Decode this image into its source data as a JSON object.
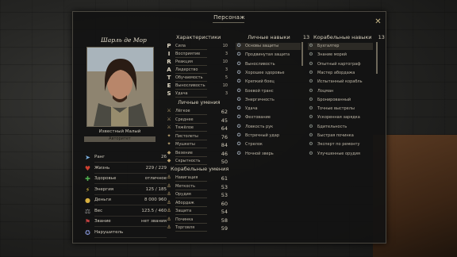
{
  "window": {
    "title": "Персонаж"
  },
  "character": {
    "name": "Шарль де Мор",
    "rank": "Известный Малый",
    "rank_bar": "Авторитет"
  },
  "stats": [
    {
      "icon": "arrow-icon",
      "glyph": "➤",
      "color": "#7ab0e0",
      "label": "Ранг",
      "value": "26"
    },
    {
      "icon": "heart-icon",
      "glyph": "♥",
      "color": "#d04030",
      "label": "Жизнь",
      "value": "229 / 229"
    },
    {
      "icon": "health-icon",
      "glyph": "✚",
      "color": "#50b050",
      "label": "Здоровье",
      "value": "отличное"
    },
    {
      "icon": "energy-icon",
      "glyph": "⚡",
      "color": "#e0c040",
      "label": "Энергия",
      "value": "125 / 185"
    },
    {
      "icon": "money-icon",
      "glyph": "●",
      "color": "#d8b040",
      "label": "Деньги",
      "value": "8 000 960"
    },
    {
      "icon": "weight-icon",
      "glyph": "⚖",
      "color": "#a0a0a0",
      "label": "Вес",
      "value": "123.5 / 460"
    },
    {
      "icon": "flag-icon",
      "glyph": "⚑",
      "color": "#c04040",
      "label": "Звание",
      "value": "нет звания"
    },
    {
      "icon": "compass-icon",
      "glyph": "✪",
      "color": "#8090d0",
      "label": "Нарушитель",
      "value": ""
    }
  ],
  "characteristics": {
    "header": "Характеристики",
    "items": [
      {
        "letter": "P",
        "label": "Сила",
        "value": "10"
      },
      {
        "letter": "I",
        "label": "Восприятие",
        "value": "3"
      },
      {
        "letter": "R",
        "label": "Реакция",
        "value": "10"
      },
      {
        "letter": "A",
        "label": "Лидерство",
        "value": "3"
      },
      {
        "letter": "T",
        "label": "Обучаемость",
        "value": "5"
      },
      {
        "letter": "E",
        "label": "Выносливость",
        "value": "10"
      },
      {
        "letter": "S",
        "label": "Удача",
        "value": "3"
      }
    ]
  },
  "personal_skills": {
    "header": "Личные умения",
    "items": [
      {
        "glyph": "⚔",
        "label": "Лёгкое",
        "value": "62"
      },
      {
        "glyph": "⚔",
        "label": "Среднее",
        "value": "45"
      },
      {
        "glyph": "⚔",
        "label": "Тяжёлое",
        "value": "64"
      },
      {
        "glyph": "✦",
        "label": "Пистолеты",
        "value": "76"
      },
      {
        "glyph": "✦",
        "label": "Мушкеты",
        "value": "84"
      },
      {
        "glyph": "◆",
        "label": "Везение",
        "value": "46"
      },
      {
        "glyph": "◆",
        "label": "Скрытность",
        "value": "50"
      }
    ]
  },
  "ship_skills": {
    "header": "Корабельные умения",
    "items": [
      {
        "glyph": "⚓",
        "label": "Навигация",
        "value": "61"
      },
      {
        "glyph": "⚓",
        "label": "Меткость",
        "value": "53"
      },
      {
        "glyph": "⚓",
        "label": "Орудия",
        "value": "53"
      },
      {
        "glyph": "⚓",
        "label": "Абордаж",
        "value": "60"
      },
      {
        "glyph": "⚓",
        "label": "Защита",
        "value": "54"
      },
      {
        "glyph": "⚓",
        "label": "Починка",
        "value": "58"
      },
      {
        "glyph": "⚓",
        "label": "Торговля",
        "value": "59"
      }
    ]
  },
  "personal_abilities": {
    "header": "Личные навыки",
    "count": "13",
    "items": [
      "Основы защиты",
      "Продвинутая защита",
      "Выносливость",
      "Хорошее здоровье",
      "Крепкий боец",
      "Боевой транс",
      "Энергичность",
      "Удача",
      "Фехтование",
      "Ловкость рук",
      "Встречный удар",
      "Стрелок",
      "Ночной зверь"
    ]
  },
  "ship_abilities": {
    "header": "Корабельные навыки",
    "count": "13",
    "items": [
      "Бухгалтер",
      "Знание морей",
      "Опытный картограф",
      "Мастер абордажа",
      "Испытанный корабль",
      "Лоцман",
      "Бронированный",
      "Точные выстрелы",
      "Ускоренная зарядка",
      "Бдительность",
      "Быстрая починка",
      "Эксперт по ремонту",
      "Улучшенные орудия"
    ]
  }
}
